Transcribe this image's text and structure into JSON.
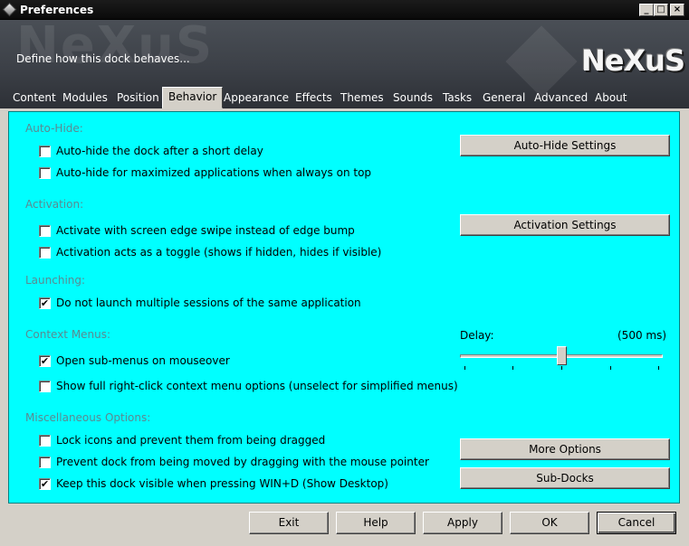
{
  "window": {
    "title": "Preferences",
    "controls": [
      "_",
      "□",
      "×"
    ]
  },
  "header": {
    "description": "Define how this dock behaves...",
    "logo": "NeXuS",
    "watermark": "NeXuS"
  },
  "tabs": [
    "Content",
    "Modules",
    "Position",
    "Behavior",
    "Appearance",
    "Effects",
    "Themes",
    "Sounds",
    "Tasks",
    "General",
    "Advanced",
    "About"
  ],
  "active_tab": "Behavior",
  "sections": {
    "autohide": {
      "title": "Auto-Hide:",
      "options": [
        {
          "label": "Auto-hide the dock after a short delay",
          "checked": false
        },
        {
          "label": "Auto-hide for maximized applications when always on top",
          "checked": false
        }
      ],
      "button": "Auto-Hide Settings"
    },
    "activation": {
      "title": "Activation:",
      "options": [
        {
          "label": "Activate with screen edge swipe instead of edge bump",
          "checked": false
        },
        {
          "label": "Activation acts as a toggle (shows if hidden, hides if visible)",
          "checked": false
        }
      ],
      "button": "Activation Settings"
    },
    "launching": {
      "title": "Launching:",
      "options": [
        {
          "label": "Do not launch multiple sessions of the same application",
          "checked": true
        }
      ]
    },
    "context_menus": {
      "title": "Context Menus:",
      "options": [
        {
          "label": "Open sub-menus on mouseover",
          "checked": true
        },
        {
          "label": "Show full right-click context menu options (unselect for simplified menus)",
          "checked": false
        }
      ],
      "delay_label": "Delay:",
      "delay_value": "(500 ms)",
      "delay_fraction": 0.5
    },
    "misc": {
      "title": "Miscellaneous Options:",
      "options": [
        {
          "label": "Lock icons and prevent them from being dragged",
          "checked": false
        },
        {
          "label": "Prevent dock from being moved by dragging with the mouse pointer",
          "checked": false
        },
        {
          "label": "Keep this dock visible when pressing WIN+D (Show Desktop)",
          "checked": true
        }
      ],
      "buttons": [
        "More Options",
        "Sub-Docks"
      ]
    }
  },
  "footer": {
    "buttons": [
      "Exit",
      "Help",
      "Apply",
      "OK",
      "Cancel"
    ]
  },
  "colors": {
    "panel_bg": "#00ffff",
    "section_title": "#5a8a92",
    "header_bg": "#3c4047",
    "titlebar_bg": "#111111"
  }
}
